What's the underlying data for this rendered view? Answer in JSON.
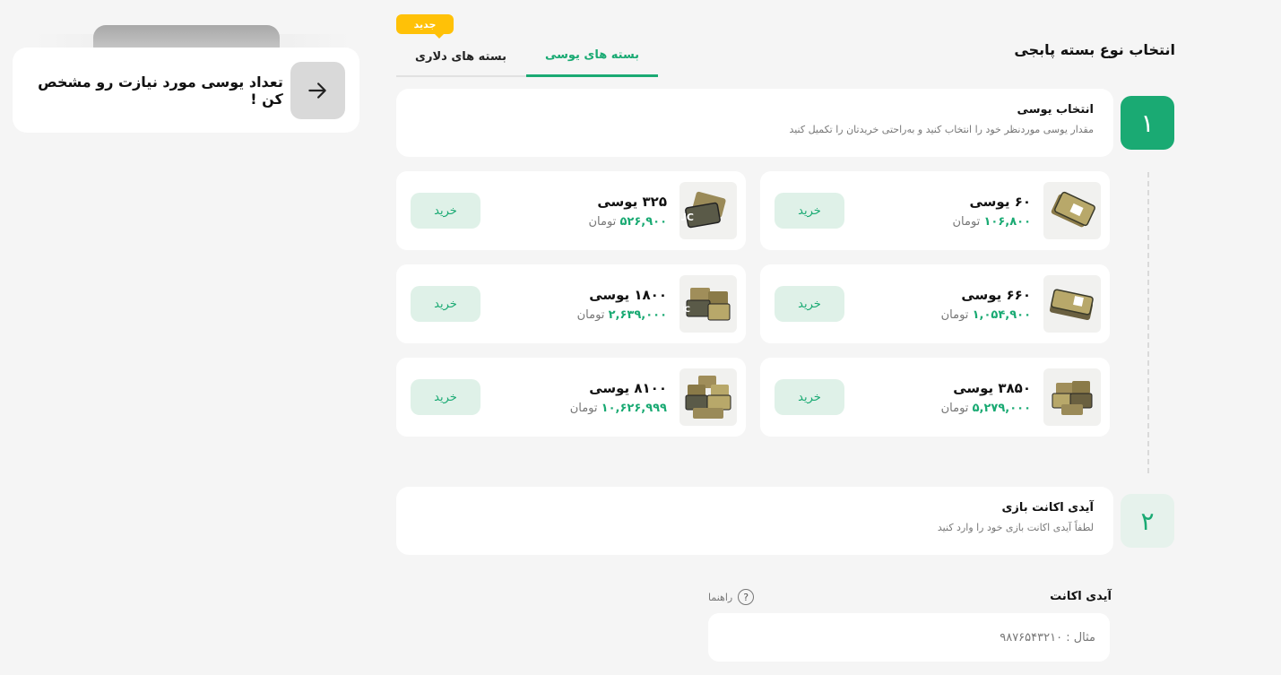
{
  "notice": {
    "text": "تعداد یوسی مورد نیازت رو مشخص کن !"
  },
  "header": {
    "title": "انتخاب نوع بسته پابجی"
  },
  "tabs": [
    {
      "label": "بسته های یوسی",
      "active": true
    },
    {
      "label": "بسته های دلاری",
      "active": false,
      "badge": "جدید"
    }
  ],
  "step1": {
    "number": "۱",
    "title": "انتخاب یوسی",
    "description": "مقدار یوسی موردنظر خود را انتخاب کنید و به‌راحتی خریدتان را تکمیل کنید"
  },
  "currency": "تومان",
  "buy_label": "خرید",
  "packages": [
    {
      "amount": "۶۰ یوسی",
      "price": "۱۰۶,۸۰۰"
    },
    {
      "amount": "۳۲۵ یوسی",
      "price": "۵۲۶,۹۰۰"
    },
    {
      "amount": "۶۶۰ یوسی",
      "price": "۱,۰۵۴,۹۰۰"
    },
    {
      "amount": "۱۸۰۰ یوسی",
      "price": "۲,۶۳۹,۰۰۰"
    },
    {
      "amount": "۳۸۵۰ یوسی",
      "price": "۵,۲۷۹,۰۰۰"
    },
    {
      "amount": "۸۱۰۰ یوسی",
      "price": "۱۰,۶۲۶,۹۹۹"
    }
  ],
  "step2": {
    "number": "۲",
    "title": "آیدی اکانت بازی",
    "description": "لطفاً آیدی اکانت بازی خود را وارد کنید"
  },
  "account_field": {
    "label": "آیدی اکانت",
    "help": "راهنما",
    "placeholder": "مثال : ۹۸۷۶۵۴۳۲۱۰"
  },
  "colors": {
    "accent": "#1aaa73",
    "badge": "#ffc107",
    "buy_bg": "#dff1e8"
  }
}
